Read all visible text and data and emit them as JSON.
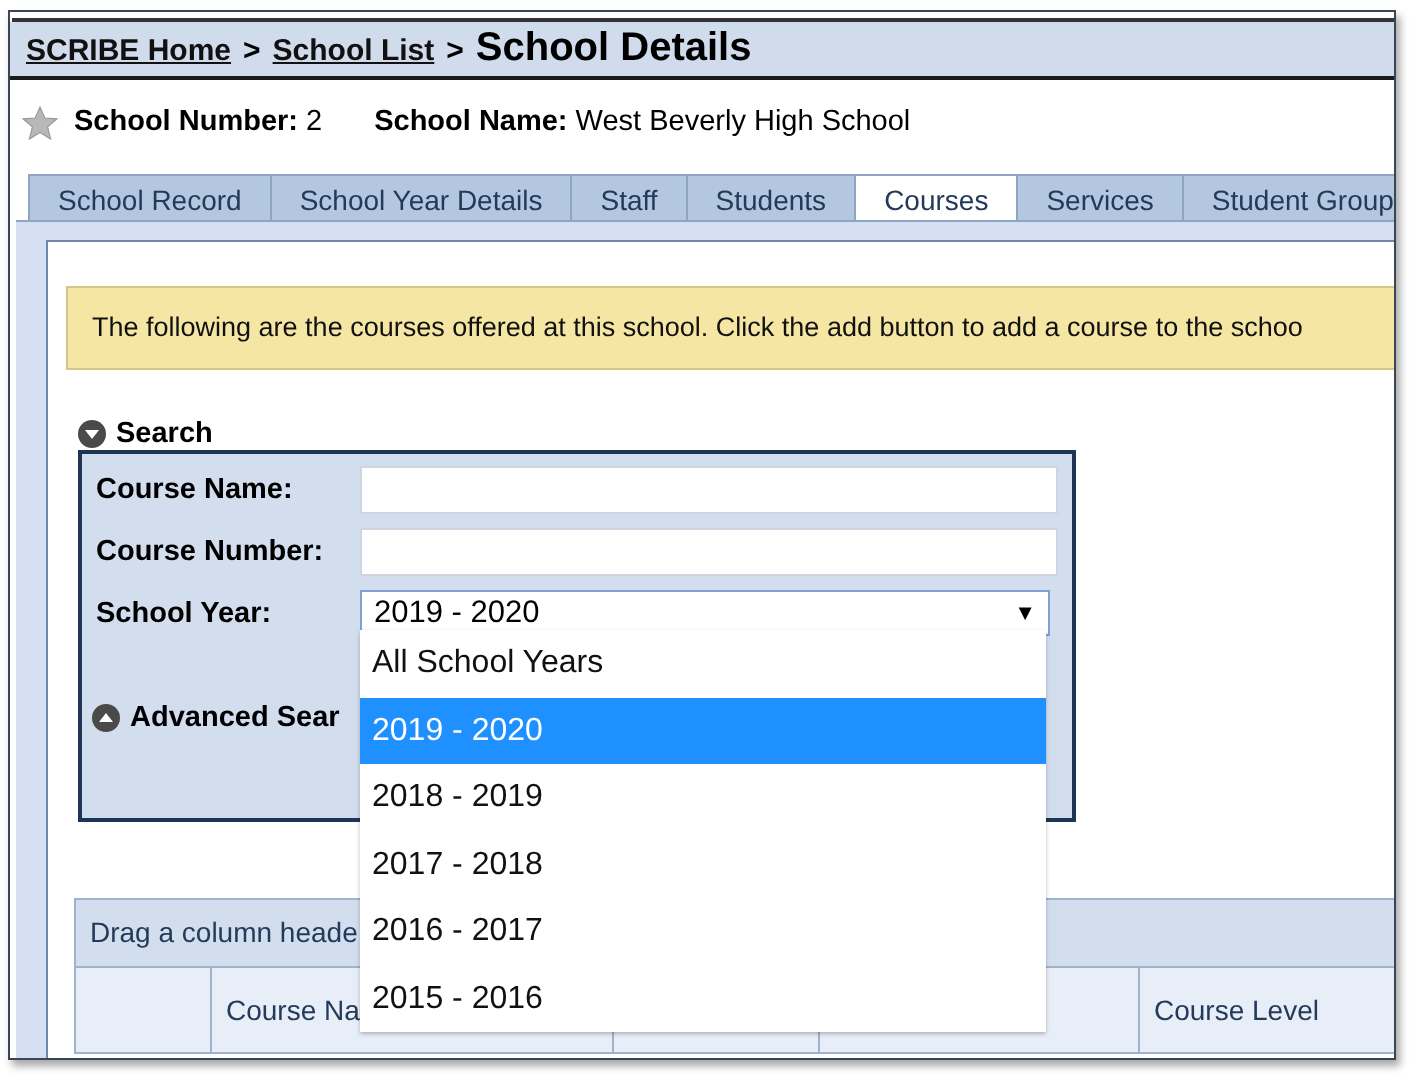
{
  "breadcrumb": [
    {
      "kind": "link",
      "text": "SCRIBE Home"
    },
    {
      "kind": "separator",
      "text": ">"
    },
    {
      "kind": "link",
      "text": "School List"
    },
    {
      "kind": "separator",
      "text": ">"
    },
    {
      "kind": "current",
      "text": "School Details"
    }
  ],
  "info": [
    {
      "label": "School Number:",
      "value": "2"
    },
    {
      "label": "School Name:",
      "value": "West Beverly High School"
    }
  ],
  "tabs": [
    {
      "label": "School Record",
      "selected": false
    },
    {
      "label": "School Year Details",
      "selected": false
    },
    {
      "label": "Staff",
      "selected": false
    },
    {
      "label": "Students",
      "selected": false
    },
    {
      "label": "Courses",
      "selected": true
    },
    {
      "label": "Services",
      "selected": false
    },
    {
      "label": "Student Group",
      "selected": false
    }
  ],
  "banner": "The following are the courses offered at this school.  Click the add button to add a course to the schoo",
  "search": {
    "title": "Search",
    "expanded": true,
    "fields": [
      {
        "kind": "text",
        "label": "Course Name:"
      },
      {
        "kind": "text",
        "label": "Course Number:"
      },
      {
        "kind": "select",
        "label": "School Year:",
        "value": "2019 - 2020",
        "arrow": "▼",
        "open": true,
        "options": [
          {
            "label": "All School Years",
            "selected": false
          },
          {
            "label": "2019 - 2020",
            "selected": true
          },
          {
            "label": "2018 - 2019",
            "selected": false
          },
          {
            "label": "2017 - 2018",
            "selected": false
          },
          {
            "label": "2016 - 2017",
            "selected": false
          },
          {
            "label": "2015 - 2016",
            "selected": false
          }
        ]
      }
    ]
  },
  "advanced_search": {
    "title": "Advanced Sear",
    "expanded": false
  },
  "grid": {
    "group_hint": "Drag a column heade",
    "columns": [
      {
        "kind": "blank"
      },
      {
        "kind": "label",
        "label": "Course Na"
      },
      {
        "kind": "blank"
      },
      {
        "kind": "blank"
      },
      {
        "kind": "label",
        "label": "Course Level"
      }
    ]
  }
}
